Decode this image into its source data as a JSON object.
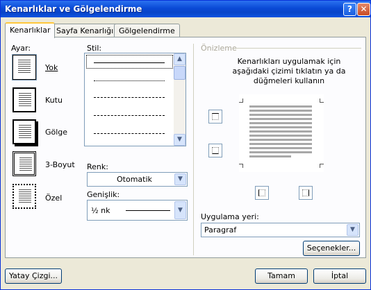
{
  "window": {
    "title": "Kenarlıklar ve Gölgelendirme",
    "help": "?",
    "close": "✕"
  },
  "tabs": [
    {
      "label": "Kenarlıklar",
      "active": true
    },
    {
      "label": "Sayfa Kenarlığı",
      "active": false
    },
    {
      "label": "Gölgelendirme",
      "active": false
    }
  ],
  "setting": {
    "label": "Ayar:",
    "items": [
      "Yok",
      "Kutu",
      "Gölge",
      "3-Boyut",
      "Özel"
    ]
  },
  "style": {
    "label": "Stil:"
  },
  "color": {
    "label": "Renk:",
    "value": "Otomatik"
  },
  "width": {
    "label": "Genişlik:",
    "value": "½ nk"
  },
  "preview": {
    "label": "Önizleme",
    "instructions": "Kenarlıkları uygulamak için aşağıdaki çizimi tıklatın ya da düğmeleri kullanın"
  },
  "apply": {
    "label": "Uygulama yeri:",
    "value": "Paragraf"
  },
  "buttons": {
    "options": "Seçenekler...",
    "horizontal_line": "Yatay Çizgi...",
    "ok": "Tamam",
    "cancel": "İptal"
  }
}
